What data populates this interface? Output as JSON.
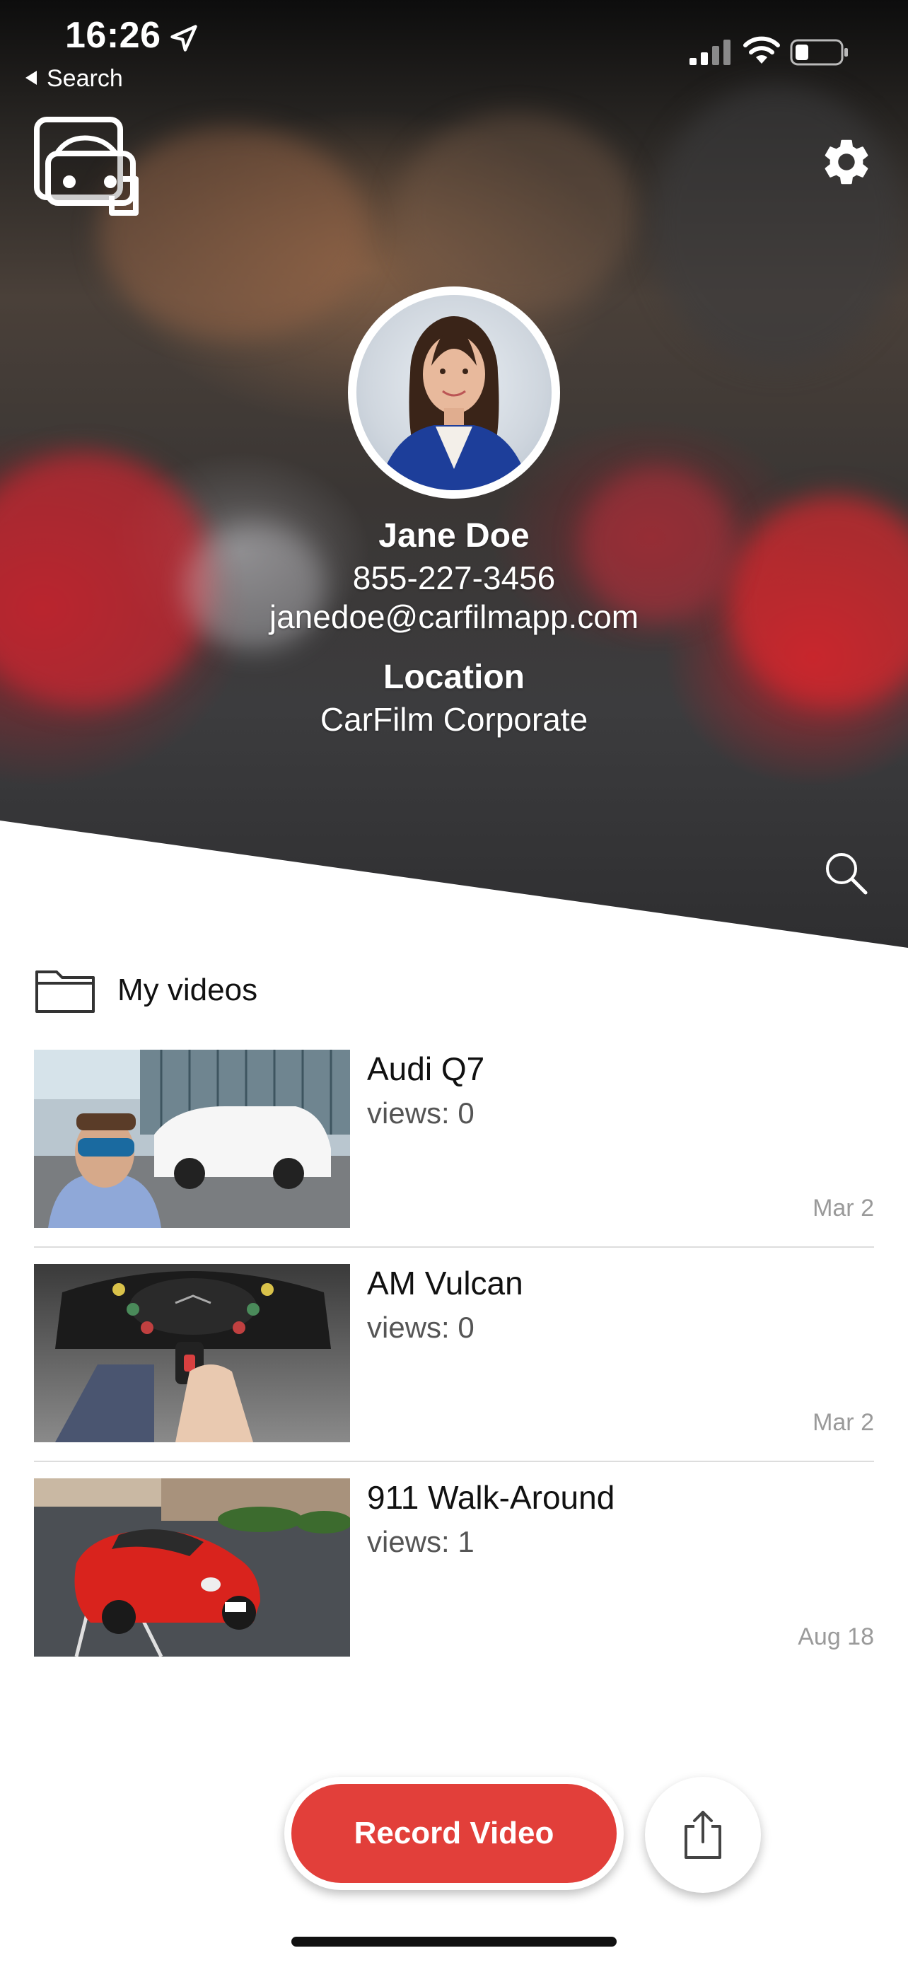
{
  "status_bar": {
    "time": "16:26",
    "back_label": "Search"
  },
  "profile": {
    "name": "Jane Doe",
    "phone": "855-227-3456",
    "email": "janedoe@carfilmapp.com",
    "location_label": "Location",
    "location_value": "CarFilm Corporate"
  },
  "section": {
    "title": "My videos"
  },
  "videos": [
    {
      "title": "Audi Q7",
      "views": "views: 0",
      "date": "Mar 2"
    },
    {
      "title": "AM Vulcan",
      "views": "views: 0",
      "date": "Mar 2"
    },
    {
      "title": "911 Walk-Around",
      "views": "views: 1",
      "date": "Aug 18"
    }
  ],
  "actions": {
    "record_label": "Record Video"
  },
  "colors": {
    "accent": "#e23f3a"
  },
  "icons": [
    "location-arrow-icon",
    "cellular-signal-icon",
    "wifi-icon",
    "battery-icon",
    "app-logo-icon",
    "gear-icon",
    "search-icon",
    "folder-icon",
    "share-icon"
  ]
}
